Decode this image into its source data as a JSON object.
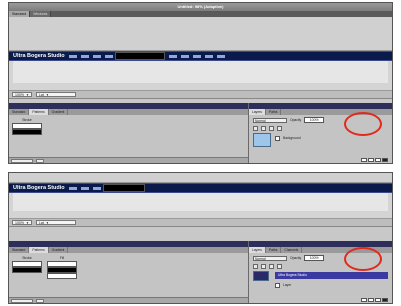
{
  "screenshot1": {
    "window_title": "Untitled: 98% (Adaptive)",
    "tabs": [
      "Standard",
      "Windows"
    ],
    "main_text": "Ultra Bogera Studio",
    "toolbar": {
      "zoom": "100%",
      "mode": "Lat"
    },
    "left_panel": {
      "tabs": [
        "Standard",
        "Patterns",
        "Gradient"
      ],
      "swatch_label": "Stroke"
    },
    "right_panel": {
      "tabs": [
        "Layers",
        "Paths"
      ],
      "blend_mode": "Normal",
      "opacity_label": "Opacity",
      "opacity_value": "100%",
      "layer_name": "Background"
    }
  },
  "screenshot2": {
    "main_text": "Ultra Bogera Studio",
    "toolbar": {
      "zoom": "100%",
      "mode": "Lat"
    },
    "left_panel": {
      "tabs": [
        "Standard",
        "Patterns",
        "Gradient"
      ],
      "col1_label": "Stroke",
      "col2_label": "Fill"
    },
    "right_panel": {
      "tabs": [
        "Layers",
        "Paths",
        "Channels"
      ],
      "blend_mode": "Normal",
      "opacity_label": "Opacity",
      "opacity_value": "100%",
      "layer_name": "Ultra Bogera Studio",
      "layer_name2": "Layer"
    }
  },
  "colors": {
    "highlight": "#e02a1c",
    "text_line_bg": "#0a1a4a",
    "selection": "#3a3aa0"
  }
}
